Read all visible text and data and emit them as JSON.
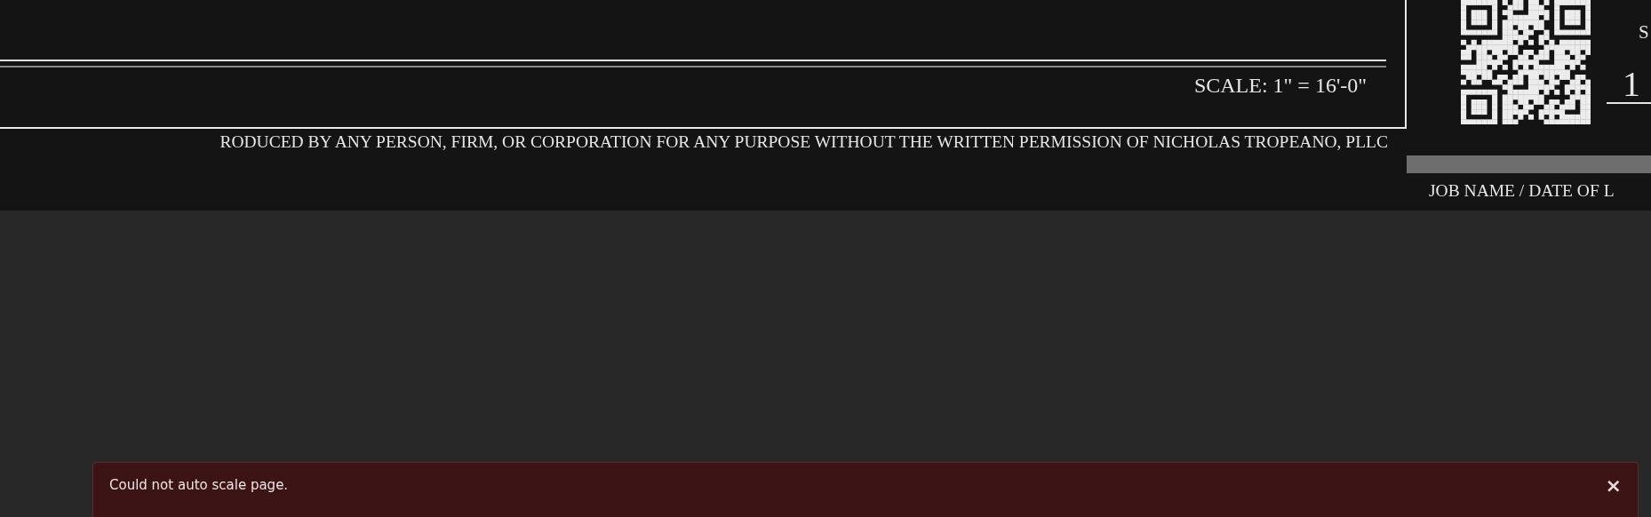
{
  "drawing_sheet": {
    "scale_note": "SCALE: 1\" = 16'-0\"",
    "disclaimer": "RODUCED BY ANY PERSON, FIRM, OR CORPORATION FOR ANY PURPOSE WITHOUT THE WRITTEN PERMISSION OF NICHOLAS TROPEANO, PLLC",
    "sheet_label": "S",
    "sheet_number": "1",
    "title_label": "JOB NAME / DATE OF L"
  },
  "notification": {
    "message": "Could not auto scale page.",
    "close": "×"
  }
}
